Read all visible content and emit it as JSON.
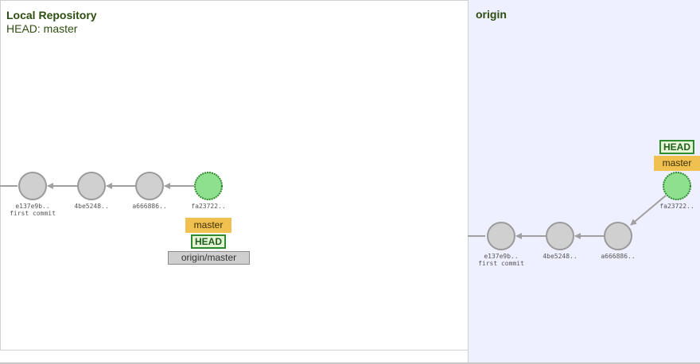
{
  "local": {
    "title": "Local Repository",
    "head_label": "HEAD: master",
    "commits": [
      {
        "id": "e137e9b..",
        "message": "first commit",
        "current": false
      },
      {
        "id": "4be5248..",
        "message": "",
        "current": false
      },
      {
        "id": "a666886..",
        "message": "",
        "current": false
      },
      {
        "id": "fa23722..",
        "message": "",
        "current": true
      }
    ],
    "tags": {
      "branch": "master",
      "head": "HEAD",
      "remote": "origin/master"
    }
  },
  "origin": {
    "title": "origin",
    "commits": [
      {
        "id": "e137e9b..",
        "message": "first commit",
        "current": false
      },
      {
        "id": "4be5248..",
        "message": "",
        "current": false
      },
      {
        "id": "a666886..",
        "message": "",
        "current": false
      },
      {
        "id": "fa23722..",
        "message": "",
        "current": true
      }
    ],
    "tags": {
      "head": "HEAD",
      "branch": "master"
    }
  },
  "colors": {
    "commit_fill": "#d0d0d0",
    "commit_stroke": "#9a9a9a",
    "current_fill": "#8ee08e",
    "current_stroke": "#2d8a2d",
    "arrow": "#a0a0a0",
    "branch_tag": "#f0c050",
    "origin_bg": "#eef0ff"
  }
}
